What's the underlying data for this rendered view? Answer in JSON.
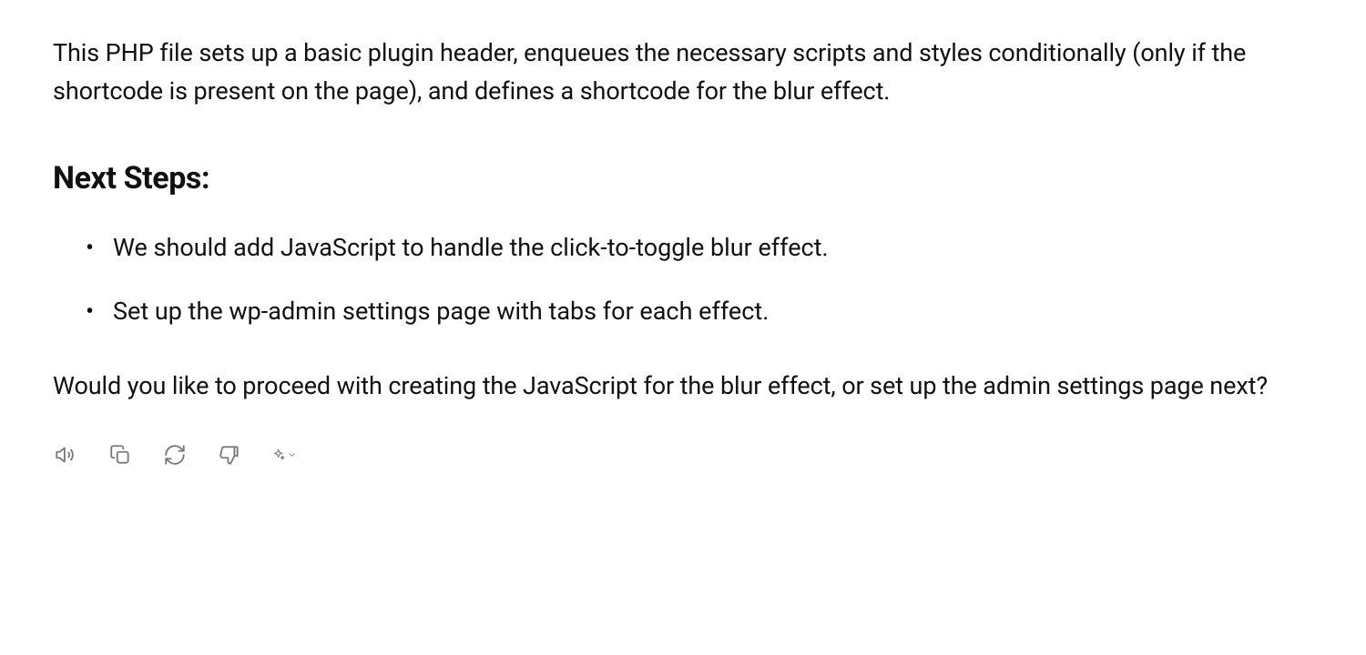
{
  "content": {
    "intro": "This PHP file sets up a basic plugin header, enqueues the necessary scripts and styles conditionally (only if the shortcode is present on the page), and defines a shortcode for the blur effect.",
    "heading": "Next Steps:",
    "bullets": [
      "We should add JavaScript to handle the click-to-toggle blur effect.",
      "Set up the wp-admin settings page with tabs for each effect."
    ],
    "followup": "Would you like to proceed with creating the JavaScript for the blur effect, or set up the admin settings page next?"
  }
}
